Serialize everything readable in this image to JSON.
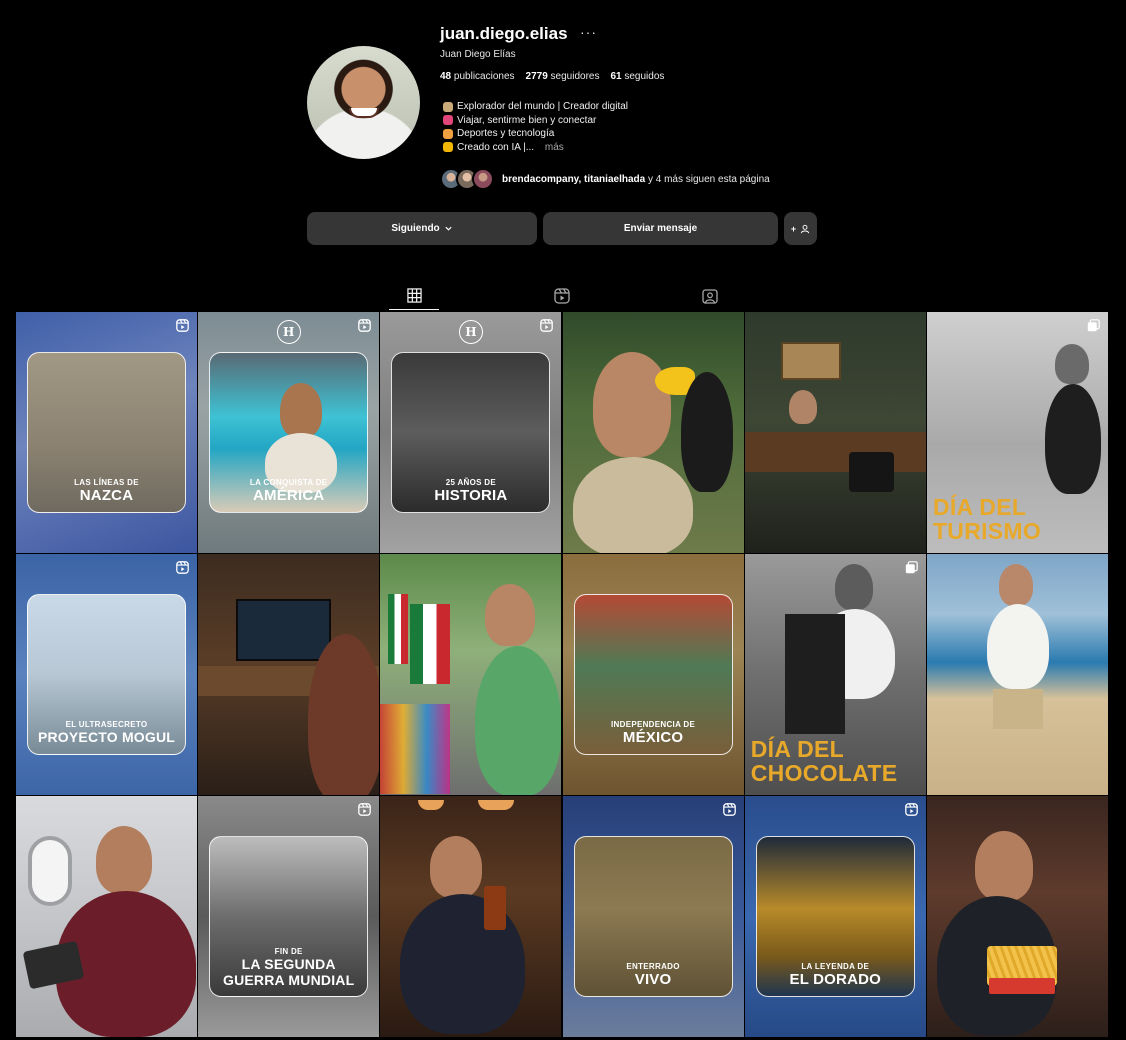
{
  "profile": {
    "username": "juan.diego.elias",
    "more": "···",
    "full_name": "Juan Diego Elías",
    "stats": {
      "posts_count": "48",
      "posts_label": "publicaciones",
      "followers_count": "2779",
      "followers_label": "seguidores",
      "following_count": "61",
      "following_label": "seguidos"
    },
    "bio": [
      {
        "icon": "globe-emoji-icon",
        "color": "#c8a97a",
        "text": "Explorador del mundo | Creador digital"
      },
      {
        "icon": "backpack-emoji-icon",
        "color": "#e0457b",
        "text": "Viajar, sentirme bien y conectar"
      },
      {
        "icon": "runner-emoji-icon",
        "color": "#f0a040",
        "text": "Deportes y tecnología"
      },
      {
        "icon": "cool-face-emoji-icon",
        "color": "#f2b705",
        "text": "Creado con IA |..."
      }
    ],
    "bio_more": "más",
    "followed_by": {
      "names": "brendacompany, titaniaelhada",
      "rest": "y 4 más siguen esta página"
    }
  },
  "actions": {
    "follow_label": "Siguiendo",
    "message_label": "Enviar mensaje",
    "add_label": "+"
  },
  "tabs": [
    {
      "name": "posts",
      "icon": "grid-icon",
      "active": true
    },
    {
      "name": "reels",
      "icon": "reels-icon",
      "active": false
    },
    {
      "name": "tagged",
      "icon": "tagged-icon",
      "active": false
    }
  ],
  "posts": [
    {
      "sub": "Las líneas de",
      "title": "NAZCA",
      "reel": true
    },
    {
      "sub": "La conquista de",
      "title": "AMÉRICA",
      "reel": true,
      "logo": "H"
    },
    {
      "sub": "25 años de",
      "title": "HISTORIA",
      "reel": true,
      "logo": "H"
    },
    {
      "sub": "",
      "title": "",
      "reel": false
    },
    {
      "sub": "",
      "title": "",
      "reel": false
    },
    {
      "sub": "",
      "title": "DÍA DEL TURISMO",
      "reel": false,
      "multi": true
    },
    {
      "sub": "El ultrasecreto",
      "title": "PROYECTO MOGUL",
      "reel": true
    },
    {
      "sub": "",
      "title": "",
      "reel": false
    },
    {
      "sub": "",
      "title": "",
      "reel": false
    },
    {
      "sub": "Independencia de",
      "title": "MÉXICO",
      "reel": false
    },
    {
      "sub": "",
      "title": "DÍA DEL CHOCOLATE",
      "reel": false,
      "multi": true
    },
    {
      "sub": "",
      "title": "",
      "reel": false
    },
    {
      "sub": "",
      "title": "",
      "reel": false
    },
    {
      "sub": "Fin de",
      "title": "LA SEGUNDA GUERRA MUNDIAL",
      "reel": true
    },
    {
      "sub": "",
      "title": "",
      "reel": false
    },
    {
      "sub": "Enterrado",
      "title": "VIVO",
      "reel": true
    },
    {
      "sub": "La leyenda de",
      "title": "EL DORADO",
      "reel": true
    },
    {
      "sub": "",
      "title": "",
      "reel": false
    }
  ]
}
